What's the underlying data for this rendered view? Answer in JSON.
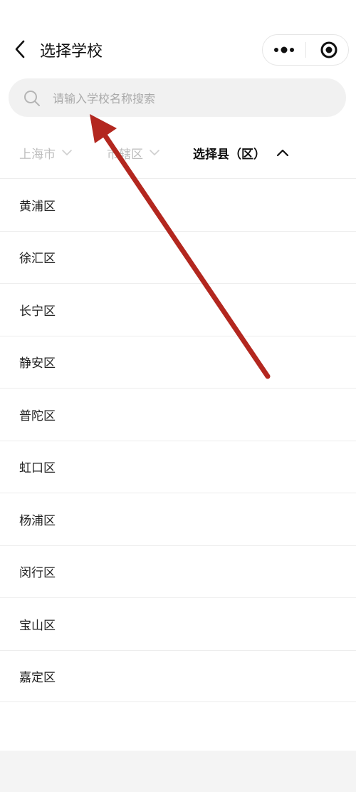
{
  "nav": {
    "title": "选择学校"
  },
  "search": {
    "placeholder": "请输入学校名称搜索"
  },
  "filters": [
    {
      "label": "上海市"
    },
    {
      "label": "市辖区"
    },
    {
      "label": "选择县（区）"
    }
  ],
  "districts": [
    {
      "name": "黄浦区"
    },
    {
      "name": "徐汇区"
    },
    {
      "name": "长宁区"
    },
    {
      "name": "静安区"
    },
    {
      "name": "普陀区"
    },
    {
      "name": "虹口区"
    },
    {
      "name": "杨浦区"
    },
    {
      "name": "闵行区"
    },
    {
      "name": "宝山区"
    },
    {
      "name": "嘉定区"
    }
  ],
  "colors": {
    "annotation_arrow": "#b3271f",
    "search_bg": "#f1f1f1",
    "inactive_filter": "#bdbdbd"
  }
}
